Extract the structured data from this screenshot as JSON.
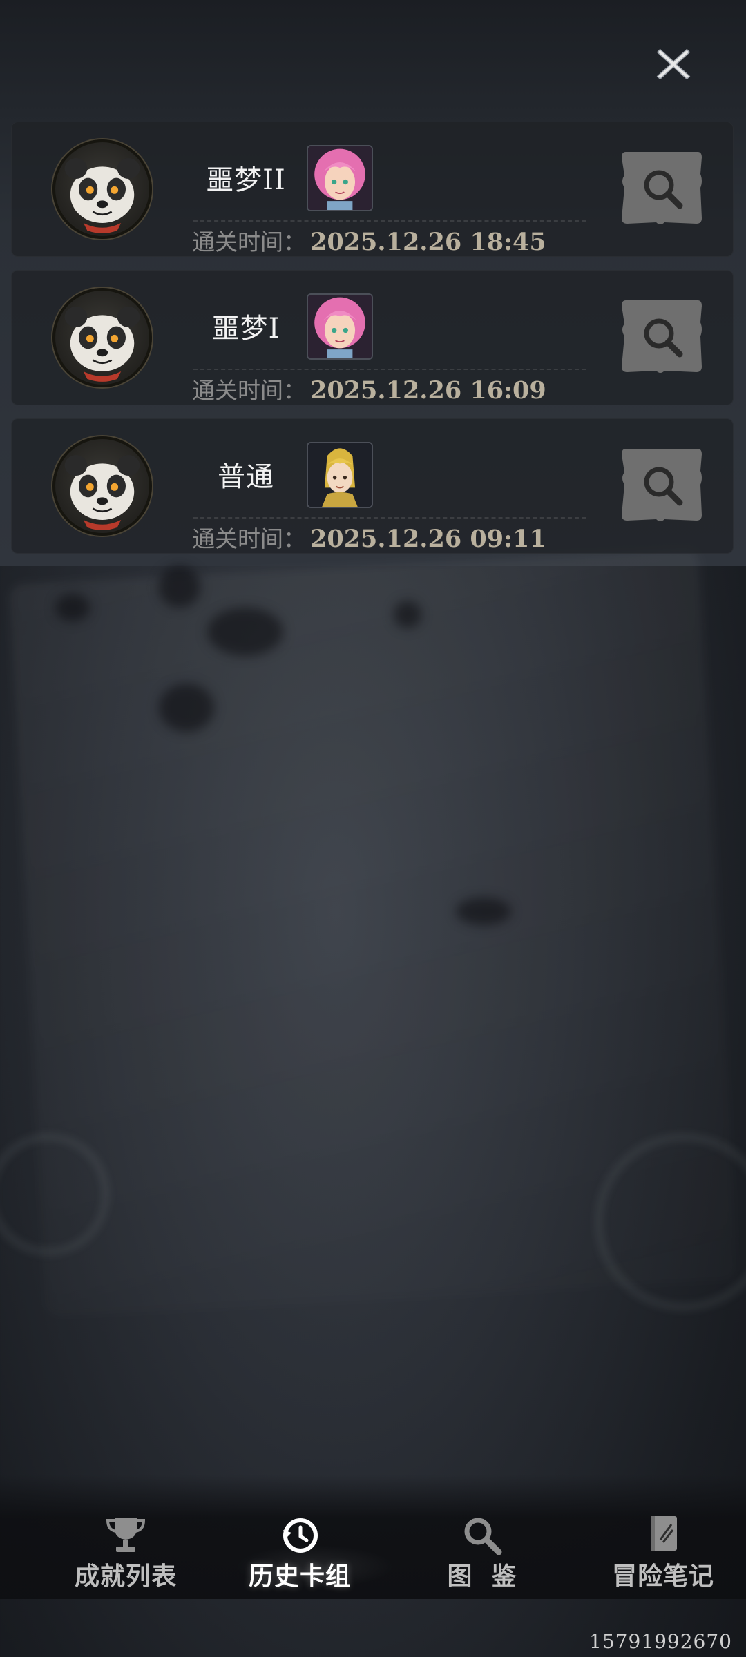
{
  "header": {
    "close_icon": "close-icon"
  },
  "records": [
    {
      "avatar": "panda-avatar",
      "difficulty": "噩梦II",
      "hero": "pink-hair-hero",
      "time_label": "通关时间：",
      "time_value": "2025.12.26 18:45",
      "search_icon": "magnifier-icon"
    },
    {
      "avatar": "panda-avatar",
      "difficulty": "噩梦I",
      "hero": "pink-hair-hero",
      "time_label": "通关时间：",
      "time_value": "2025.12.26 16:09",
      "search_icon": "magnifier-icon"
    },
    {
      "avatar": "panda-avatar",
      "difficulty": "普通",
      "hero": "blonde-hero",
      "time_label": "通关时间：",
      "time_value": "2025.12.26 09:11",
      "search_icon": "magnifier-icon"
    }
  ],
  "nav": {
    "items": [
      {
        "label": "成就列表",
        "icon": "trophy-icon",
        "active": false
      },
      {
        "label": "历史卡组",
        "icon": "history-icon",
        "active": true
      },
      {
        "label": "图  鉴",
        "icon": "search-icon",
        "active": false
      },
      {
        "label": "冒险笔记",
        "icon": "notebook-icon",
        "active": false
      }
    ]
  },
  "device_id": "15791992670",
  "colors": {
    "time_value": "#b9b09d",
    "time_label": "#8b8b8b",
    "card_bg": "#1e2126"
  }
}
